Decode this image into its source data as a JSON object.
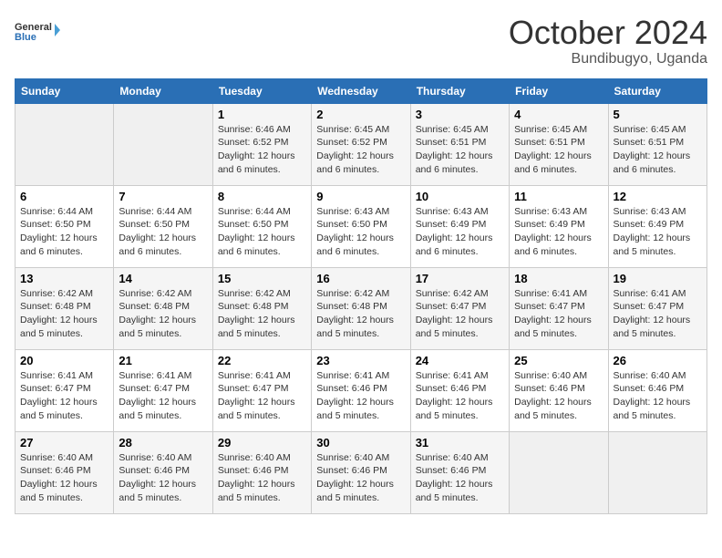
{
  "header": {
    "logo_line1": "General",
    "logo_line2": "Blue",
    "month": "October 2024",
    "location": "Bundibugyo, Uganda"
  },
  "days_of_week": [
    "Sunday",
    "Monday",
    "Tuesday",
    "Wednesday",
    "Thursday",
    "Friday",
    "Saturday"
  ],
  "weeks": [
    [
      {
        "day": "",
        "info": ""
      },
      {
        "day": "",
        "info": ""
      },
      {
        "day": "1",
        "info": "Sunrise: 6:46 AM\nSunset: 6:52 PM\nDaylight: 12 hours\nand 6 minutes."
      },
      {
        "day": "2",
        "info": "Sunrise: 6:45 AM\nSunset: 6:52 PM\nDaylight: 12 hours\nand 6 minutes."
      },
      {
        "day": "3",
        "info": "Sunrise: 6:45 AM\nSunset: 6:51 PM\nDaylight: 12 hours\nand 6 minutes."
      },
      {
        "day": "4",
        "info": "Sunrise: 6:45 AM\nSunset: 6:51 PM\nDaylight: 12 hours\nand 6 minutes."
      },
      {
        "day": "5",
        "info": "Sunrise: 6:45 AM\nSunset: 6:51 PM\nDaylight: 12 hours\nand 6 minutes."
      }
    ],
    [
      {
        "day": "6",
        "info": "Sunrise: 6:44 AM\nSunset: 6:50 PM\nDaylight: 12 hours\nand 6 minutes."
      },
      {
        "day": "7",
        "info": "Sunrise: 6:44 AM\nSunset: 6:50 PM\nDaylight: 12 hours\nand 6 minutes."
      },
      {
        "day": "8",
        "info": "Sunrise: 6:44 AM\nSunset: 6:50 PM\nDaylight: 12 hours\nand 6 minutes."
      },
      {
        "day": "9",
        "info": "Sunrise: 6:43 AM\nSunset: 6:50 PM\nDaylight: 12 hours\nand 6 minutes."
      },
      {
        "day": "10",
        "info": "Sunrise: 6:43 AM\nSunset: 6:49 PM\nDaylight: 12 hours\nand 6 minutes."
      },
      {
        "day": "11",
        "info": "Sunrise: 6:43 AM\nSunset: 6:49 PM\nDaylight: 12 hours\nand 6 minutes."
      },
      {
        "day": "12",
        "info": "Sunrise: 6:43 AM\nSunset: 6:49 PM\nDaylight: 12 hours\nand 5 minutes."
      }
    ],
    [
      {
        "day": "13",
        "info": "Sunrise: 6:42 AM\nSunset: 6:48 PM\nDaylight: 12 hours\nand 5 minutes."
      },
      {
        "day": "14",
        "info": "Sunrise: 6:42 AM\nSunset: 6:48 PM\nDaylight: 12 hours\nand 5 minutes."
      },
      {
        "day": "15",
        "info": "Sunrise: 6:42 AM\nSunset: 6:48 PM\nDaylight: 12 hours\nand 5 minutes."
      },
      {
        "day": "16",
        "info": "Sunrise: 6:42 AM\nSunset: 6:48 PM\nDaylight: 12 hours\nand 5 minutes."
      },
      {
        "day": "17",
        "info": "Sunrise: 6:42 AM\nSunset: 6:47 PM\nDaylight: 12 hours\nand 5 minutes."
      },
      {
        "day": "18",
        "info": "Sunrise: 6:41 AM\nSunset: 6:47 PM\nDaylight: 12 hours\nand 5 minutes."
      },
      {
        "day": "19",
        "info": "Sunrise: 6:41 AM\nSunset: 6:47 PM\nDaylight: 12 hours\nand 5 minutes."
      }
    ],
    [
      {
        "day": "20",
        "info": "Sunrise: 6:41 AM\nSunset: 6:47 PM\nDaylight: 12 hours\nand 5 minutes."
      },
      {
        "day": "21",
        "info": "Sunrise: 6:41 AM\nSunset: 6:47 PM\nDaylight: 12 hours\nand 5 minutes."
      },
      {
        "day": "22",
        "info": "Sunrise: 6:41 AM\nSunset: 6:47 PM\nDaylight: 12 hours\nand 5 minutes."
      },
      {
        "day": "23",
        "info": "Sunrise: 6:41 AM\nSunset: 6:46 PM\nDaylight: 12 hours\nand 5 minutes."
      },
      {
        "day": "24",
        "info": "Sunrise: 6:41 AM\nSunset: 6:46 PM\nDaylight: 12 hours\nand 5 minutes."
      },
      {
        "day": "25",
        "info": "Sunrise: 6:40 AM\nSunset: 6:46 PM\nDaylight: 12 hours\nand 5 minutes."
      },
      {
        "day": "26",
        "info": "Sunrise: 6:40 AM\nSunset: 6:46 PM\nDaylight: 12 hours\nand 5 minutes."
      }
    ],
    [
      {
        "day": "27",
        "info": "Sunrise: 6:40 AM\nSunset: 6:46 PM\nDaylight: 12 hours\nand 5 minutes."
      },
      {
        "day": "28",
        "info": "Sunrise: 6:40 AM\nSunset: 6:46 PM\nDaylight: 12 hours\nand 5 minutes."
      },
      {
        "day": "29",
        "info": "Sunrise: 6:40 AM\nSunset: 6:46 PM\nDaylight: 12 hours\nand 5 minutes."
      },
      {
        "day": "30",
        "info": "Sunrise: 6:40 AM\nSunset: 6:46 PM\nDaylight: 12 hours\nand 5 minutes."
      },
      {
        "day": "31",
        "info": "Sunrise: 6:40 AM\nSunset: 6:46 PM\nDaylight: 12 hours\nand 5 minutes."
      },
      {
        "day": "",
        "info": ""
      },
      {
        "day": "",
        "info": ""
      }
    ]
  ]
}
